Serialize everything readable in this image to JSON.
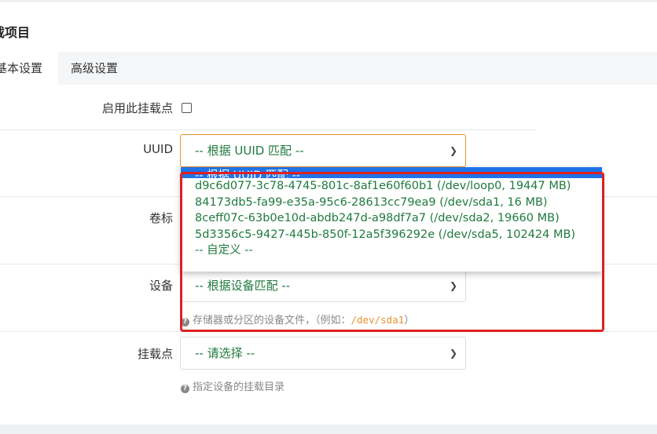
{
  "section": {
    "title": "载项目"
  },
  "tabs": [
    {
      "label": "基本设置"
    },
    {
      "label": "高级设置"
    }
  ],
  "form": {
    "enable": {
      "label": "启用此挂载点"
    },
    "uuid": {
      "label": "UUID",
      "value": "-- 根据 UUID 匹配 --",
      "options": [
        "-- 根据 UUID 匹配 --",
        "d9c6d077-3c78-4745-801c-8af1e60f60b1 (/dev/loop0, 19447 MB)",
        "84173db5-fa99-e35a-95c6-28613cc79ea9 (/dev/sda1, 16 MB)",
        "8ceff07c-63b0e10d-abdb247d-a98df7a7 (/dev/sda2, 19660 MB)",
        "5d3356c5-9427-445b-850f-12a5f396292e (/dev/sda5, 102424 MB)",
        "-- 自定义 --"
      ]
    },
    "volume_label": {
      "label": "卷标"
    },
    "device": {
      "label": "设备",
      "value": "-- 根据设备匹配 --",
      "help_text": "存储器或分区的设备文件，（例如：",
      "help_example": "/dev/sda1",
      "help_close": "）"
    },
    "mountpoint": {
      "label": "挂载点",
      "value": "-- 请选择 --",
      "help_text": "指定设备的挂载目录"
    }
  },
  "colors": {
    "accent": "#e8922e",
    "option_text": "#1f7a3d",
    "highlight": "#e02020",
    "selected": "#1e73e8"
  }
}
